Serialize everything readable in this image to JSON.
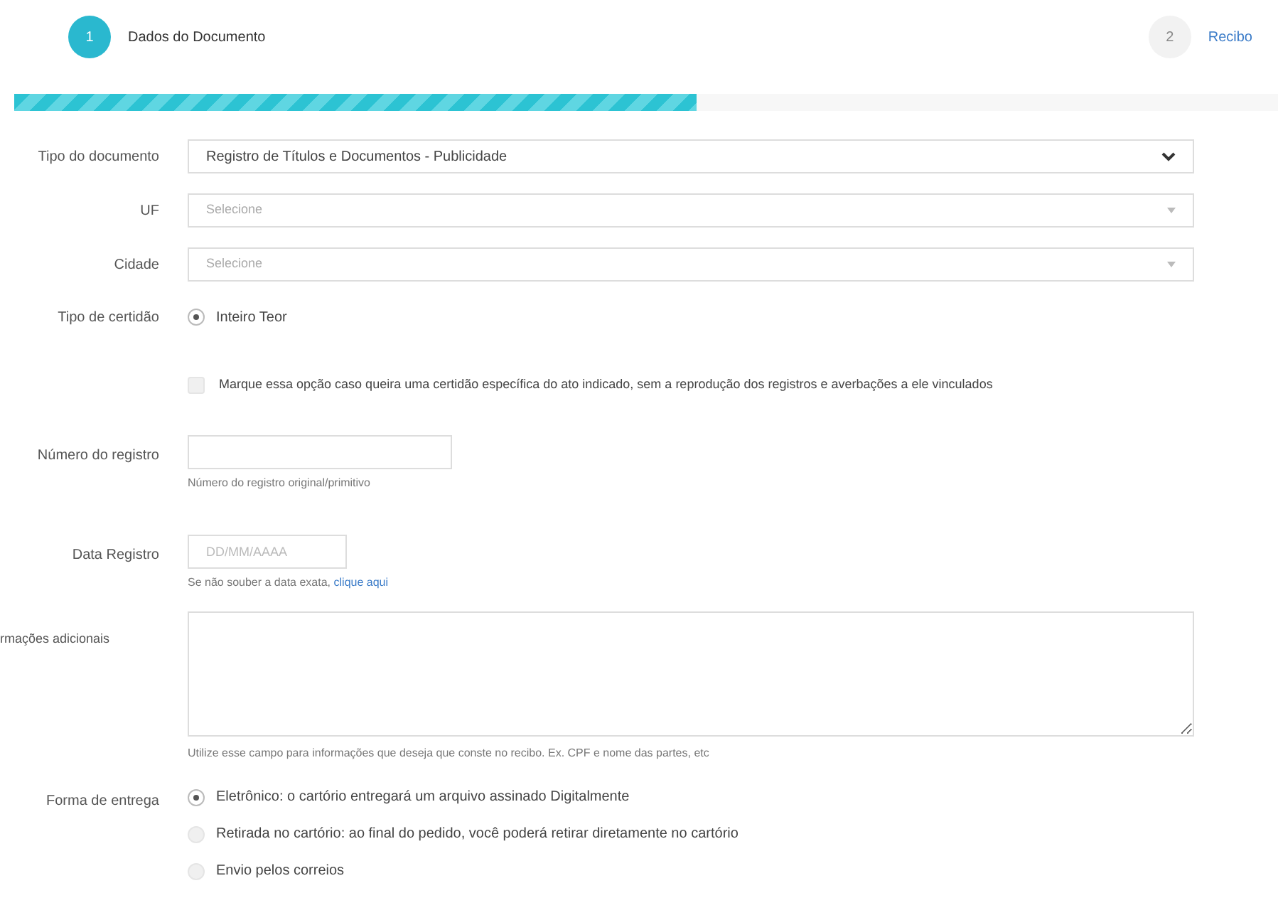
{
  "steps": [
    {
      "number": "1",
      "label": "Dados do Documento",
      "selected": true
    },
    {
      "number": "2",
      "label": "Recibo",
      "selected": false
    }
  ],
  "progress": {
    "level": 0.54
  },
  "form": {
    "tipo_documento": {
      "label": "Tipo do documento",
      "value": "Registro de Títulos e Documentos - Publicidade"
    },
    "uf": {
      "label": "UF",
      "placeholder": "Selecione"
    },
    "cidade": {
      "label": "Cidade",
      "placeholder": "Selecione"
    },
    "tipo_certidao": {
      "label": "Tipo de certidão",
      "options": [
        {
          "label": "Inteiro Teor",
          "selected": true
        }
      ]
    },
    "checkbox": {
      "label": "Marque essa opção caso queira uma certidão específica do ato indicado, sem a reprodução dos registros e averbações a ele vinculados",
      "checked": false
    },
    "numero_registro": {
      "label": "Número do registro",
      "help": "Número do registro original/primitivo"
    },
    "data_registro": {
      "label": "Data Registro",
      "placeholder": "DD/MM/AAAA",
      "help": "Se não souber a data exata,",
      "link": "clique aqui"
    },
    "informacoes": {
      "label": "rmações adicionais",
      "help": "Utilize esse campo para informações que deseja que conste no recibo. Ex. CPF e nome das partes, etc"
    },
    "forma_entrega": {
      "label": "Forma de entrega",
      "options": [
        {
          "label": "Eletrônico: o cartório entregará um arquivo assinado Digitalmente",
          "selected": true
        },
        {
          "label": "Retirada no cartório: ao final do pedido, você poderá retirar diretamente no cartório",
          "selected": false
        },
        {
          "label": "Envio pelos correios",
          "selected": false
        }
      ]
    }
  }
}
